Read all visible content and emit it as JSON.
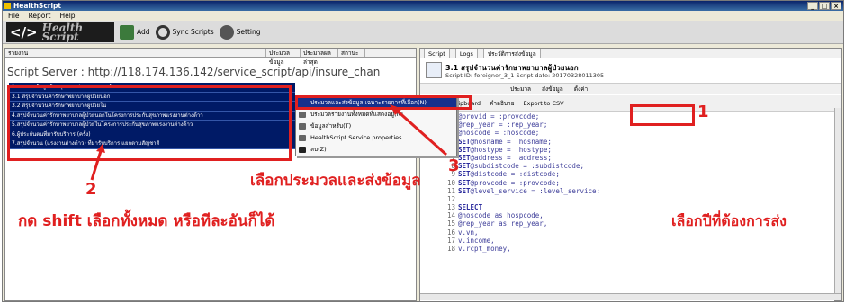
{
  "app": {
    "title": "HealthScript",
    "window_controls": [
      "_",
      "□",
      "×"
    ]
  },
  "menu": [
    "File",
    "Report",
    "Help"
  ],
  "toolbar": {
    "logo_code": "</>",
    "logo_name": "Health Script",
    "add_label": "Add",
    "sync_label": "Sync Scripts",
    "setting_label": "Setting"
  },
  "left": {
    "columns": [
      "รายงาน",
      "ประมวลข้อมูล",
      "ประมวลผลล่าสุด",
      "สถานะ"
    ],
    "server_text": "Script Server : http://118.174.136.142/service_script/api/insure_chan",
    "scripts": [
      "1.รายงานข้อมูลด้านสุขภาพประชากรรายตำบล",
      "3.1 สรุปจำนวนค่ารักษาพยาบาลผู้ป่วยนอก",
      "3.2 สรุปจำนวนค่ารักษาพยาบาลผู้ป่วยใน",
      "4.สรุปจำนวนค่ารักษาพยาบาลผู้ป่วยนอกในโครงการประกันสุขภาพแรงงานต่างด้าว",
      "5.สรุปจำนวนค่ารักษาพยาบาลผู้ป่วยในโครงการประกันสุขภาพแรงงานต่างด้าว",
      "6.ผู้ประกันตนที่มารับบริการ (ครั้ง)",
      "7.สรุปจำนวน (แรงงานต่างด้าว) ที่มารับบริการ แยกตามสัญชาติ"
    ]
  },
  "context_menu": {
    "items": [
      "ประมวลและส่งข้อมูล เฉพาะรายการที่เลือก(N)",
      "ประมวลรายงานทั้งหมดที่แสดงอยู่(N)",
      "ข้อมูลสำหรับ(T)",
      "HealthScript Service properties",
      "ลบ(Z)"
    ]
  },
  "right": {
    "tabs": [
      "Script",
      "Logs",
      "ประวัติการส่งข้อมูล"
    ],
    "script_title": "3.1 สรุปจำนวนค่ารักษาพยาบาลผู้ป่วยนอก",
    "script_meta": "Script ID: foreigner_3_1   Script date: 20170328011305",
    "subbar1": [
      "ประมวล",
      "ส่งข้อมูล",
      "ตั้งค่า"
    ],
    "subbar2": [
      "Clipboard",
      "คำอธิบาย",
      "Export to CSV"
    ],
    "year_value": "2559",
    "code_lines": [
      {
        "n": "",
        "kw": "",
        "t": "@provid = :provcode;"
      },
      {
        "n": "",
        "kw": "",
        "t": "@rep_year = :rep_year;"
      },
      {
        "n": "",
        "kw": "",
        "t": "@hoscode = :hoscode;"
      },
      {
        "n": "",
        "kw": "SET",
        "t": "@hosname = :hosname;"
      },
      {
        "n": "",
        "kw": "SET",
        "t": "@hostype = :hostype;"
      },
      {
        "n": "7",
        "kw": "SET",
        "t": "@address = :address;"
      },
      {
        "n": "8",
        "kw": "SET",
        "t": "@subdistcode = :subdistcode;"
      },
      {
        "n": "9",
        "kw": "SET",
        "t": "@distcode = :distcode;"
      },
      {
        "n": "10",
        "kw": "SET",
        "t": "@provcode = :provcode;"
      },
      {
        "n": "11",
        "kw": "SET",
        "t": "@level_service = :level_service;"
      },
      {
        "n": "12",
        "kw": "",
        "t": ""
      },
      {
        "n": "13",
        "kw": "SELECT",
        "t": ""
      },
      {
        "n": "14",
        "kw": "",
        "t": "@hoscode as hospcode,"
      },
      {
        "n": "15",
        "kw": "",
        "t": "@rep_year as rep_year,"
      },
      {
        "n": "16",
        "kw": "",
        "t": "v.vn,"
      },
      {
        "n": "17",
        "kw": "",
        "t": "v.income,"
      },
      {
        "n": "18",
        "kw": "",
        "t": "v.rcpt_money,"
      }
    ]
  },
  "annotations": {
    "num1": "1",
    "num2": "2",
    "num3": "3",
    "select_year": "เลือกปีที่ต้องการส่ง",
    "shift_select": "กด shift เลือกทั้งหมด หรือทีละอันก็ได้",
    "process_send": "เลือกประมวลและส่งข้อมูล"
  },
  "colors": {
    "annotation_red": "#e02020",
    "list_bg": "#001a66",
    "highlight": "#16308c"
  }
}
